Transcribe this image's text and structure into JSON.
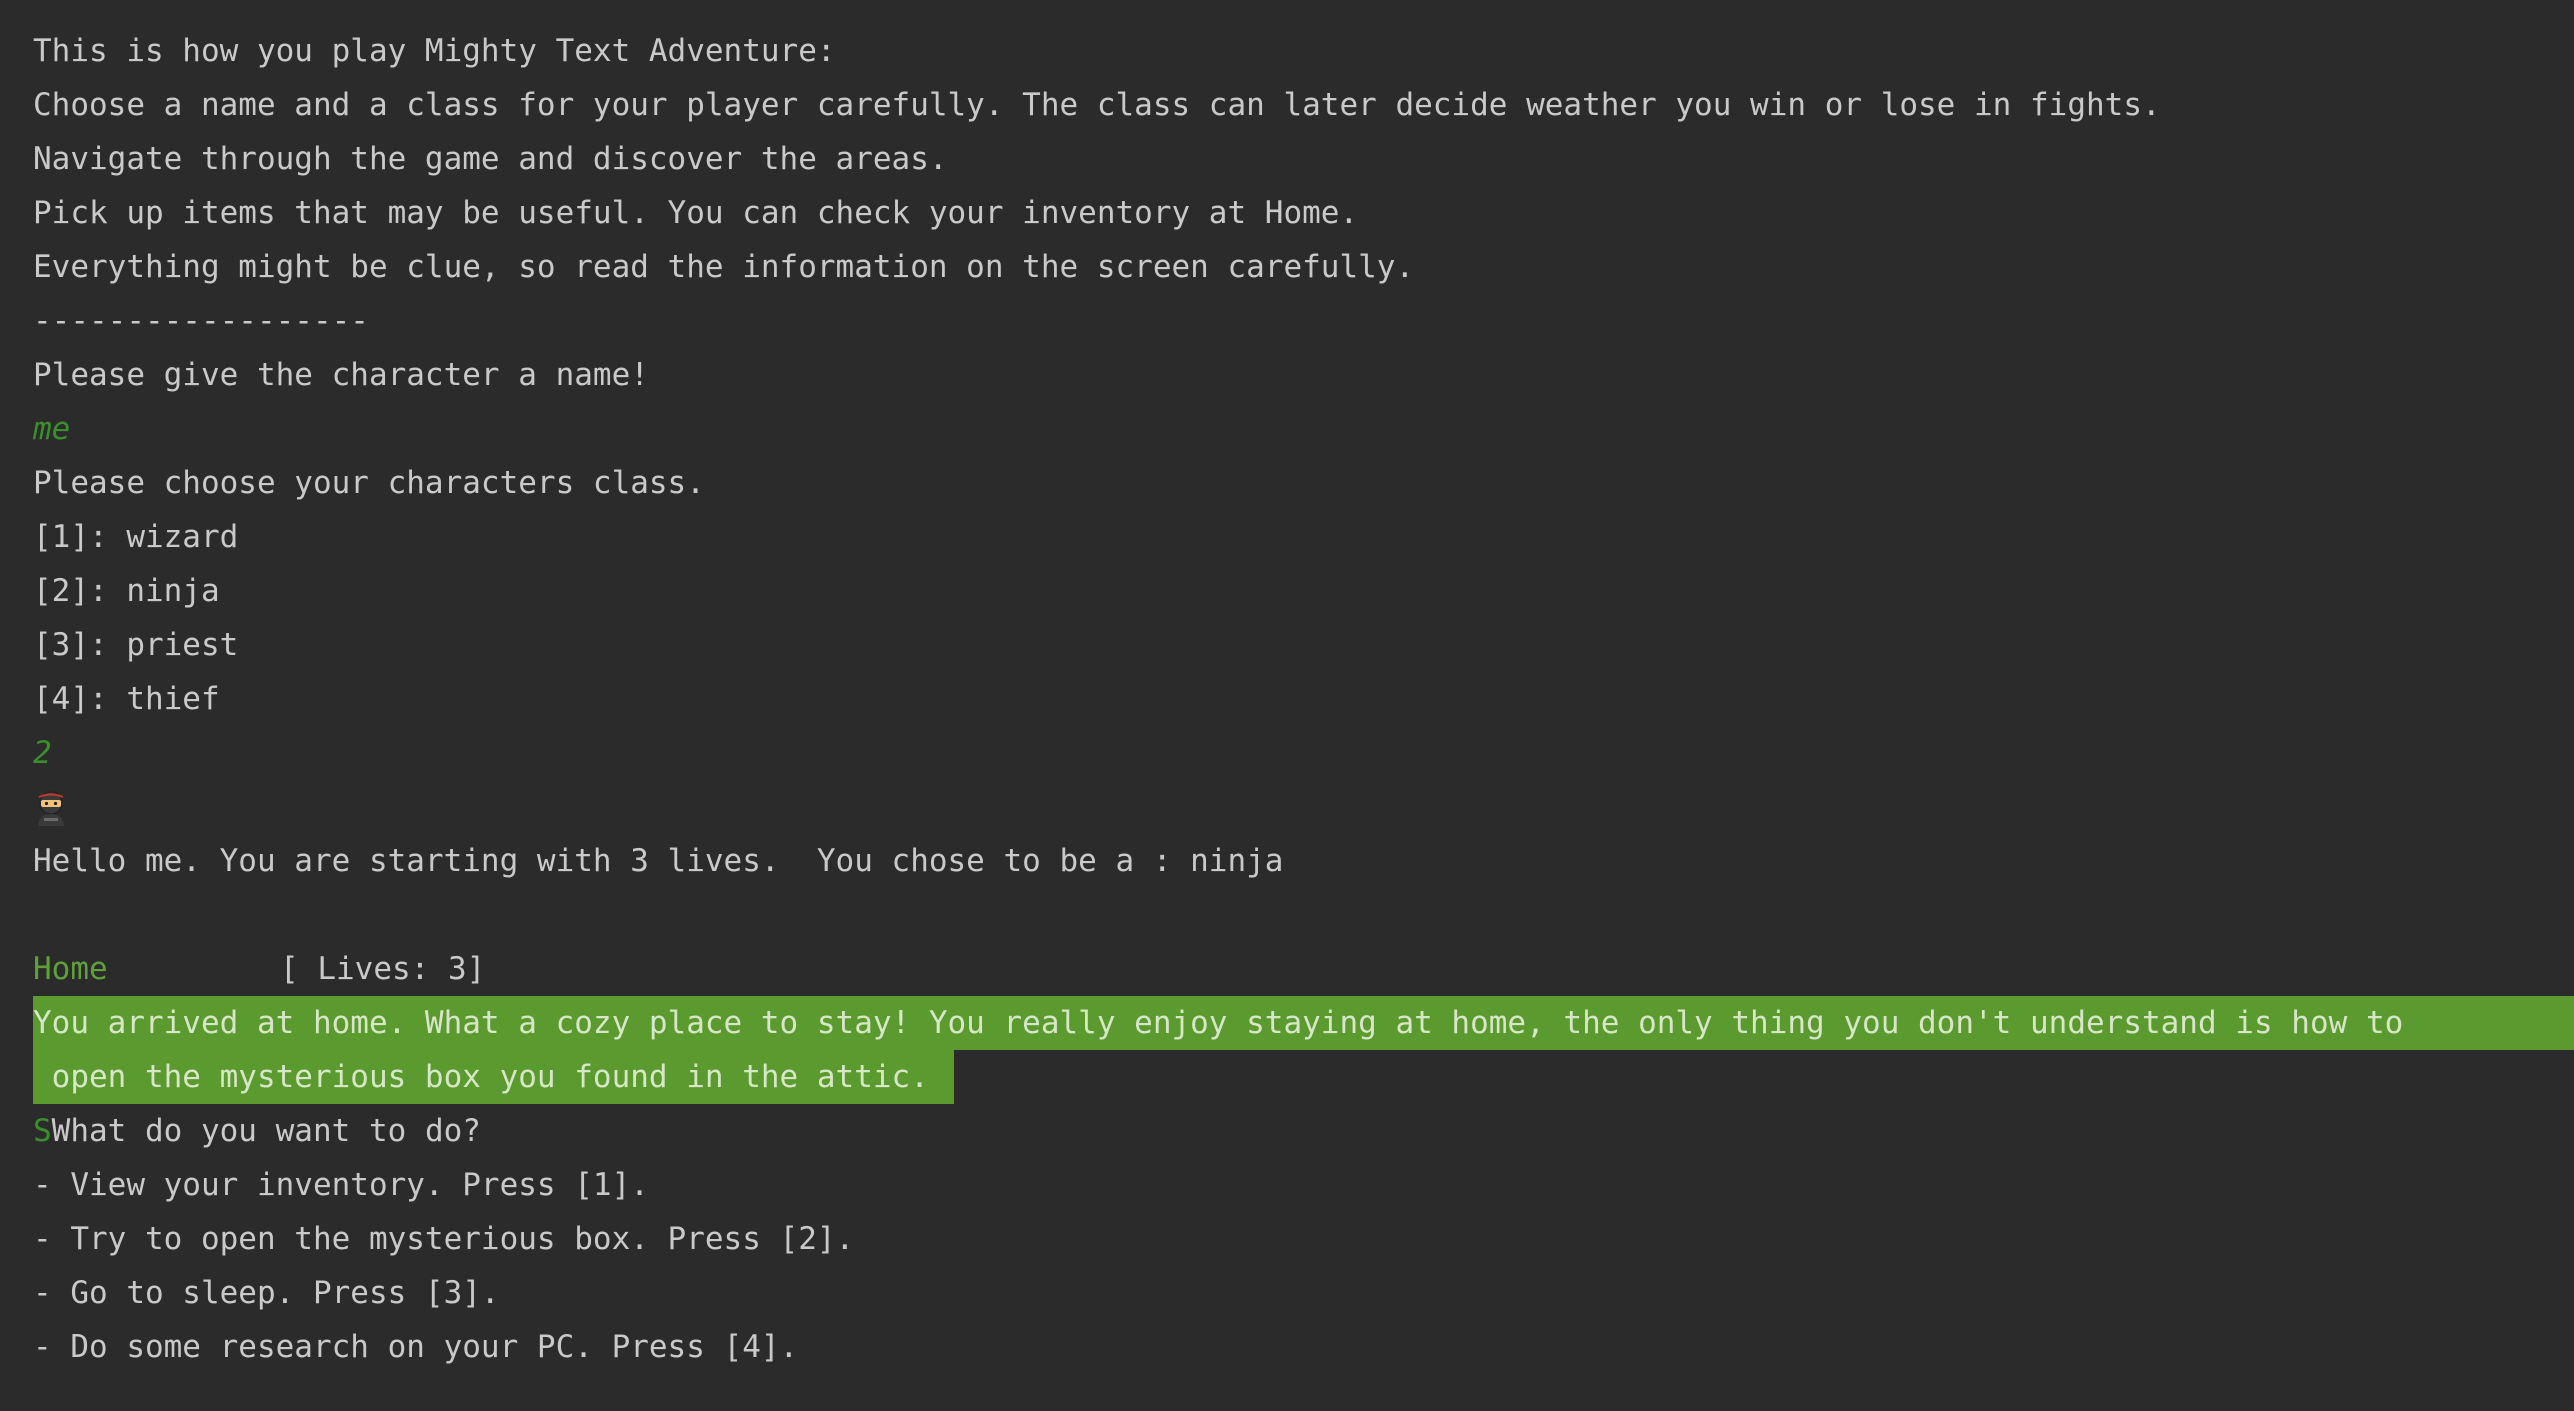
{
  "intro": {
    "line1": "This is how you play Mighty Text Adventure:",
    "line2": "Choose a name and a class for your player carefully. The class can later decide weather you win or lose in fights.",
    "line3": "Navigate through the game and discover the areas.",
    "line4": "Pick up items that may be useful. You can check your inventory at Home.",
    "line5": "Everything might be clue, so read the information on the screen carefully.",
    "separator": "------------------"
  },
  "name_prompt": "Please give the character a name!",
  "name_input": "me",
  "class_prompt": "Please choose your characters class.",
  "classes": [
    "[1]: wizard",
    "[2]: ninja",
    "[3]: priest",
    "[4]: thief"
  ],
  "class_input": "2",
  "ninja_emoji": "ninja-icon",
  "greeting": "Hello me. You are starting with 3 lives.  You chose to be a : ninja",
  "location": {
    "name": "Home",
    "lives": "[ Lives: 3]"
  },
  "description": {
    "line1": "You arrived at home. What a cozy place to stay! You really enjoy staying at home, the only thing you don't understand is how to",
    "line2": " open the mysterious box you found in the attic."
  },
  "question": {
    "marker": "S",
    "text": "What do you want to do?"
  },
  "options": [
    "- View your inventory. Press [1].",
    "- Try to open the mysterious box. Press [2].",
    "- Go to sleep. Press [3].",
    "- Do some research on your PC. Press [4]."
  ]
}
